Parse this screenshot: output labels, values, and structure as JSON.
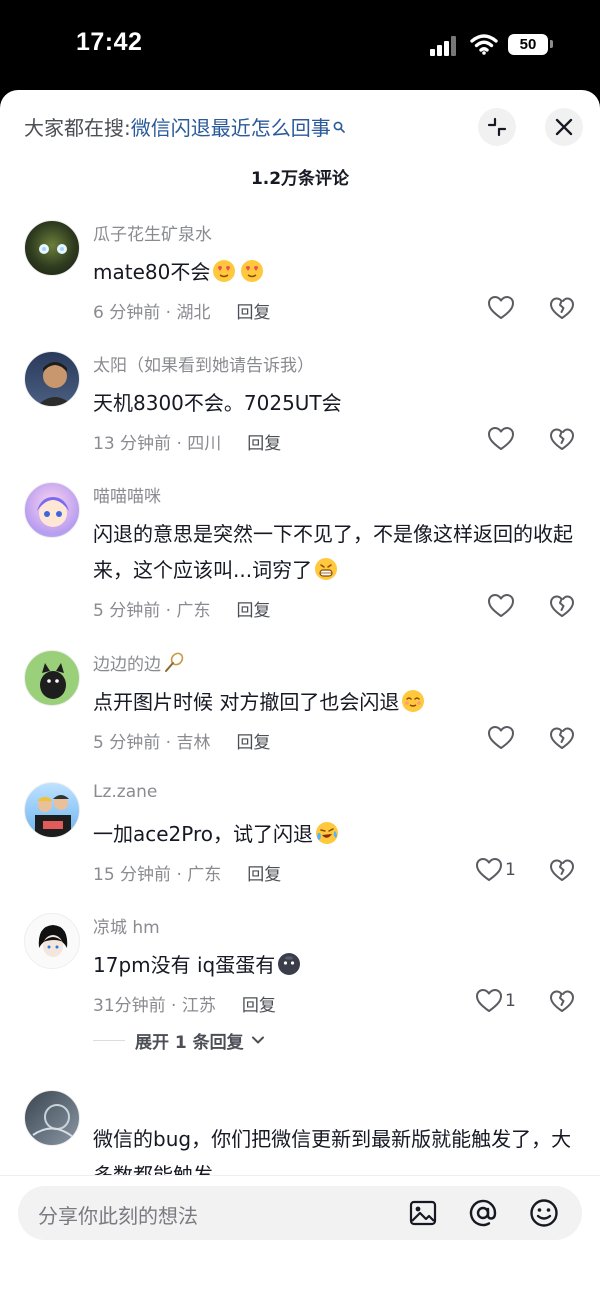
{
  "status_bar": {
    "time": "17:42",
    "battery": "50"
  },
  "header": {
    "search_prefix": "大家都在搜:",
    "search_query": "微信闪退最近怎么回事",
    "comment_count": "1.2万条评论"
  },
  "comments": [
    {
      "name": "瓜子花生矿泉水",
      "text": "mate80不会",
      "emojis": [
        "face-with-heart-eyes",
        "face-with-heart-eyes"
      ],
      "time": "6 分钟前",
      "location": "湖北",
      "reply_label": "回复",
      "likes": ""
    },
    {
      "name": "太阳（如果看到她请告诉我）",
      "text": "天机8300不会。7025UT会",
      "emojis": [],
      "time": "13 分钟前",
      "location": "四川",
      "reply_label": "回复",
      "likes": ""
    },
    {
      "name": "喵喵喵咪",
      "text": "闪退的意思是突然一下不见了，不是像这样返回的收起来，这个应该叫...词穷了",
      "emojis": [
        "grinning-face"
      ],
      "time": "5 分钟前",
      "location": "广东",
      "reply_label": "回复",
      "likes": ""
    },
    {
      "name": "边边的边",
      "name_emoji": "badminton",
      "text": "点开图片时候 对方撤回了也会闪退",
      "emojis": [
        "relieved-face"
      ],
      "time": "5 分钟前",
      "location": "吉林",
      "reply_label": "回复",
      "likes": ""
    },
    {
      "name": "Lz.zane",
      "text": "一加ace2Pro，试了闪退",
      "emojis": [
        "crying-laughing-face"
      ],
      "time": "15 分钟前",
      "location": "广东",
      "reply_label": "回复",
      "likes": "1"
    },
    {
      "name": "凉城 hm",
      "text": "17pm没有 iq蛋蛋有",
      "emojis": [
        "dark-face"
      ],
      "time": "31分钟前",
      "location": "江苏",
      "reply_label": "回复",
      "likes": "1"
    },
    {
      "name": "",
      "text": "微信的bug，你们把微信更新到最新版就能触发了，大多数都能触发",
      "emojis": [],
      "time": "",
      "location": "",
      "reply_label": "",
      "likes": ""
    }
  ],
  "expand_replies": "展开 1 条回复",
  "composer": {
    "placeholder": "分享你此刻的想法"
  },
  "icons": [
    "search-icon",
    "minimize-icon",
    "close-icon",
    "heart-icon",
    "broken-heart-icon",
    "image-icon",
    "at-icon",
    "emoji-icon",
    "chevron-down-icon"
  ]
}
